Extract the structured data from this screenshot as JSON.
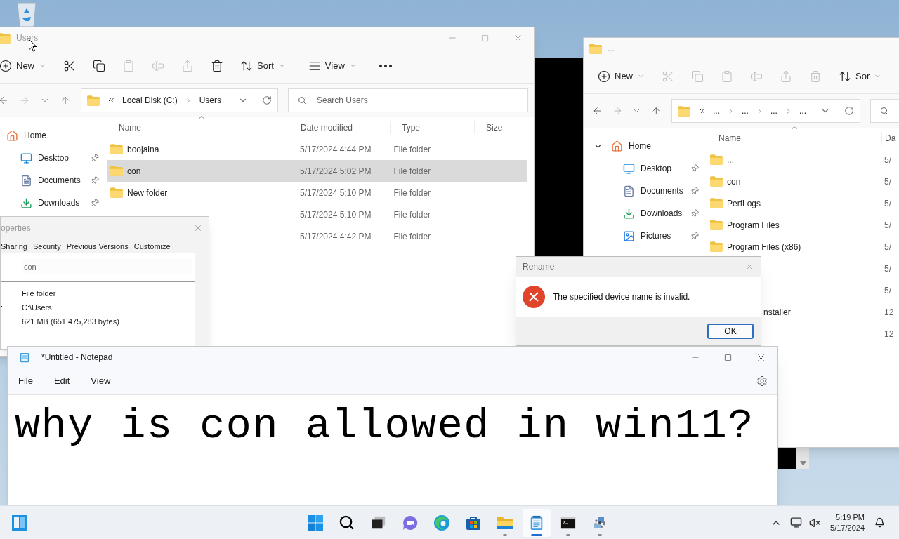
{
  "users_window": {
    "title": "Users",
    "toolbar": [
      {
        "kind": "new",
        "label": "New",
        "disabled": false
      },
      {
        "kind": "cut",
        "disabled": false
      },
      {
        "kind": "copy",
        "disabled": false
      },
      {
        "kind": "paste",
        "disabled": true
      },
      {
        "kind": "rename",
        "disabled": true
      },
      {
        "kind": "share",
        "disabled": true
      },
      {
        "kind": "delete",
        "disabled": false
      },
      {
        "kind": "sort",
        "label": "Sort",
        "disabled": false
      },
      {
        "kind": "view",
        "label": "View",
        "disabled": false
      },
      {
        "kind": "more",
        "disabled": false
      }
    ],
    "address": [
      "Local Disk (C:)",
      "Users"
    ],
    "search_placeholder": "Search Users",
    "sidebar": [
      {
        "kind": "home",
        "label": "Home",
        "pinned": false
      },
      {
        "kind": "desktop",
        "label": "Desktop",
        "pinned": true
      },
      {
        "kind": "documents",
        "label": "Documents",
        "pinned": true
      },
      {
        "kind": "downloads",
        "label": "Downloads",
        "pinned": true
      }
    ],
    "columns": [
      "Name",
      "Date modified",
      "Type",
      "Size"
    ],
    "rows": [
      {
        "name": "boojaina",
        "date": "5/17/2024 4:44 PM",
        "type": "File folder",
        "selected": false
      },
      {
        "name": "con",
        "date": "5/17/2024 5:02 PM",
        "type": "File folder",
        "selected": true
      },
      {
        "name": "New folder",
        "date": "5/17/2024 5:10 PM",
        "type": "File folder",
        "selected": false
      },
      {
        "date": "5/17/2024 5:10 PM",
        "type": "File folder",
        "selected": false
      },
      {
        "date": "5/17/2024 4:42 PM",
        "type": "File folder",
        "selected": false
      }
    ]
  },
  "back_window": {
    "title": "...",
    "toolbar": [
      {
        "kind": "new",
        "label": "New",
        "disabled": false
      },
      {
        "kind": "cut",
        "disabled": true
      },
      {
        "kind": "copy",
        "disabled": true
      },
      {
        "kind": "paste",
        "disabled": true
      },
      {
        "kind": "rename",
        "disabled": true
      },
      {
        "kind": "share",
        "disabled": true
      },
      {
        "kind": "delete",
        "disabled": true
      },
      {
        "kind": "sort",
        "label": "Sor",
        "disabled": false
      }
    ],
    "address": [
      "...",
      "...",
      "...",
      "..."
    ],
    "sidebar": [
      {
        "kind": "home",
        "label": "Home",
        "pinned": false,
        "expanded": true
      },
      {
        "kind": "desktop",
        "label": "Desktop",
        "pinned": true
      },
      {
        "kind": "documents",
        "label": "Documents",
        "pinned": true
      },
      {
        "kind": "downloads",
        "label": "Downloads",
        "pinned": true
      },
      {
        "kind": "pictures",
        "label": "Pictures",
        "pinned": true
      }
    ],
    "columns": [
      "Name",
      "Da"
    ],
    "rows": [
      {
        "name": "...",
        "date": "5/",
        "selected": false
      },
      {
        "name": "con",
        "date": "5/",
        "selected": false
      },
      {
        "name": "PerfLogs",
        "date": "5/",
        "selected": false
      },
      {
        "name": "Program Files",
        "date": "5/",
        "selected": false
      },
      {
        "name": "Program Files (x86)",
        "date": "5/",
        "selected": false
      },
      {
        "date": "5/",
        "selected": false
      },
      {
        "date": "5/",
        "selected": false
      },
      {
        "name": "nstaller",
        "name_partly_covered": true,
        "date": "12",
        "selected": false
      },
      {
        "date": "12",
        "selected": false
      }
    ]
  },
  "properties_dialog": {
    "title": "operties",
    "tabs": [
      {
        "label": "Sharing",
        "selected": false
      },
      {
        "label": "Security",
        "selected": false
      },
      {
        "label": "Previous Versions",
        "selected": false
      },
      {
        "label": "Customize",
        "selected": false
      }
    ],
    "name_value": "con",
    "rows": [
      {
        "value": "File folder"
      },
      {
        "label": ":",
        "value": "C:\\Users"
      },
      {
        "value": "621 MB (651,475,283 bytes)"
      }
    ]
  },
  "rename_dialog": {
    "title": "Rename",
    "message": "The specified device name is invalid.",
    "button": "OK"
  },
  "notepad": {
    "title": "*Untitled - Notepad",
    "menu": [
      "File",
      "Edit",
      "View"
    ],
    "text": "why is con allowed in win11?"
  },
  "taskbar": {
    "apps": [
      {
        "kind": "widgets",
        "running": false,
        "active": false
      },
      {
        "kind": "start",
        "running": false,
        "active": false
      },
      {
        "kind": "search",
        "running": false,
        "active": false
      },
      {
        "kind": "taskview",
        "running": false,
        "active": false
      },
      {
        "kind": "chat",
        "running": false,
        "active": false
      },
      {
        "kind": "browser",
        "running": false,
        "active": false
      },
      {
        "kind": "store",
        "running": false,
        "active": false
      },
      {
        "kind": "explorer",
        "running": true,
        "active": false
      },
      {
        "kind": "notepad",
        "running": true,
        "active": true
      },
      {
        "kind": "terminal",
        "running": true,
        "active": false
      },
      {
        "kind": "app",
        "running": true,
        "active": false
      }
    ],
    "time": "5:19 PM",
    "date": "5/17/2024"
  }
}
